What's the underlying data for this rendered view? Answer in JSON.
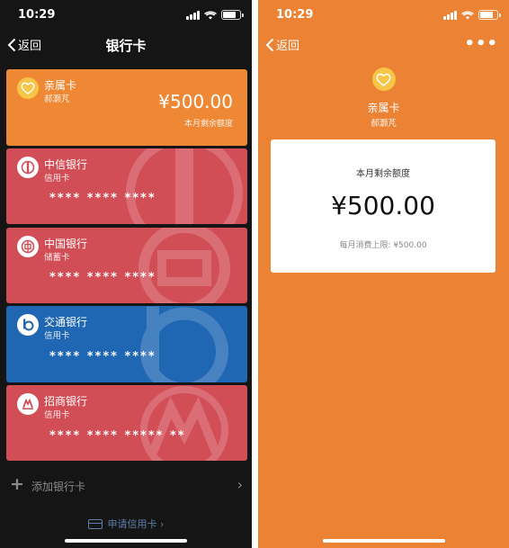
{
  "status": {
    "time": "10:29"
  },
  "left": {
    "back_label": "返回",
    "title": "银行卡",
    "family_card": {
      "name": "亲属卡",
      "holder": "郝灏芃",
      "amount": "¥500.00",
      "amount_label": "本月剩余额度"
    },
    "cards": [
      {
        "bank": "中信银行",
        "type": "信用卡",
        "number": "**** **** ****"
      },
      {
        "bank": "中国银行",
        "type": "储蓄卡",
        "number": "**** **** ****"
      },
      {
        "bank": "交通银行",
        "type": "信用卡",
        "number": "**** **** ****"
      },
      {
        "bank": "招商银行",
        "type": "信用卡",
        "number": "**** **** ***** **"
      }
    ],
    "add_card_label": "添加银行卡",
    "apply_label": "申请信用卡 ›"
  },
  "right": {
    "back_label": "返回",
    "more_label": "•••",
    "card_name": "亲属卡",
    "holder": "郝灏芃",
    "remaining_label": "本月剩余额度",
    "amount": "¥500.00",
    "limit_text": "每月消费上限: ¥500.00"
  },
  "colors": {
    "family": "#ee8834",
    "citic": "#d24e57",
    "boc": "#d24e57",
    "bocom": "#1f67b3",
    "cmb": "#d24e57",
    "right_bg": "#ec8233"
  },
  "icons": [
    "back-chevron-icon",
    "signal-icon",
    "wifi-icon",
    "battery-icon",
    "heart-card-icon",
    "citic-logo-icon",
    "boc-logo-icon",
    "bocom-logo-icon",
    "cmb-logo-icon",
    "plus-icon",
    "chevron-right-icon",
    "credit-card-icon",
    "more-icon"
  ]
}
